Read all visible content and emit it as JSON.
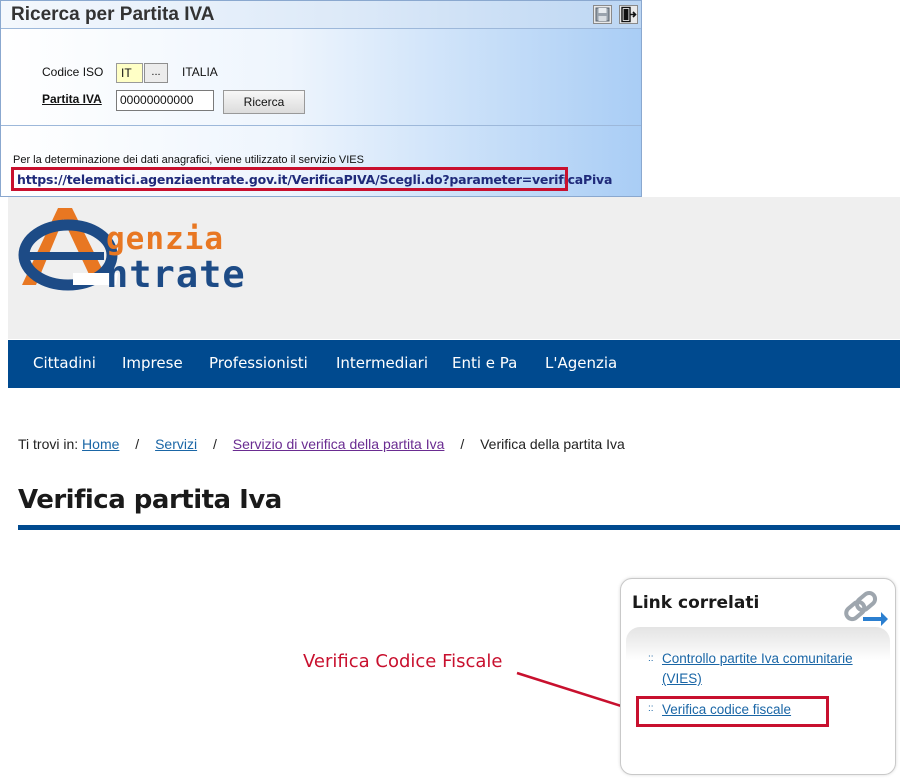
{
  "dialog": {
    "title": "Ricerca per Partita IVA",
    "save_icon": "floppy-disk-icon",
    "exit_icon": "exit-door-icon",
    "iso_label": "Codice ISO",
    "iso_value": "IT",
    "iso_browse_label": "...",
    "iso_country": "ITALIA",
    "piva_label": "Partita IVA",
    "piva_value": "00000000000",
    "search_button": "Ricerca",
    "vies_note": "Per la determinazione dei dati anagrafici, viene utilizzato il servizio VIES",
    "url": "https://telematici.agenziaentrate.gov.it/VerificaPIVA/Scegli.do?parameter=verificaPiva"
  },
  "site": {
    "logo_line1": "genzia",
    "logo_line2": "ntrate",
    "colors": {
      "nav": "#004a8f",
      "logo_orange": "#e87722",
      "logo_blue": "#1d4b86",
      "annotation": "#c8102e"
    },
    "nav": [
      "Cittadini",
      "Imprese",
      "Professionisti",
      "Intermediari",
      "Enti e Pa",
      "L'Agenzia"
    ],
    "breadcrumb": {
      "prefix": "Ti trovi in:",
      "items": [
        "Home",
        "Servizi",
        "Servizio di verifica della partita Iva",
        "Verifica della partita Iva"
      ],
      "separator": "/"
    },
    "page_title": "Verifica partita Iva",
    "related": {
      "title": "Link correlati",
      "icon": "chain-link-icon",
      "links": [
        "Controllo partite Iva comunitarie (VIES)",
        "Verifica codice fiscale"
      ],
      "bullet": "::"
    }
  },
  "annotation": {
    "label": "Verifica Codice Fiscale"
  }
}
